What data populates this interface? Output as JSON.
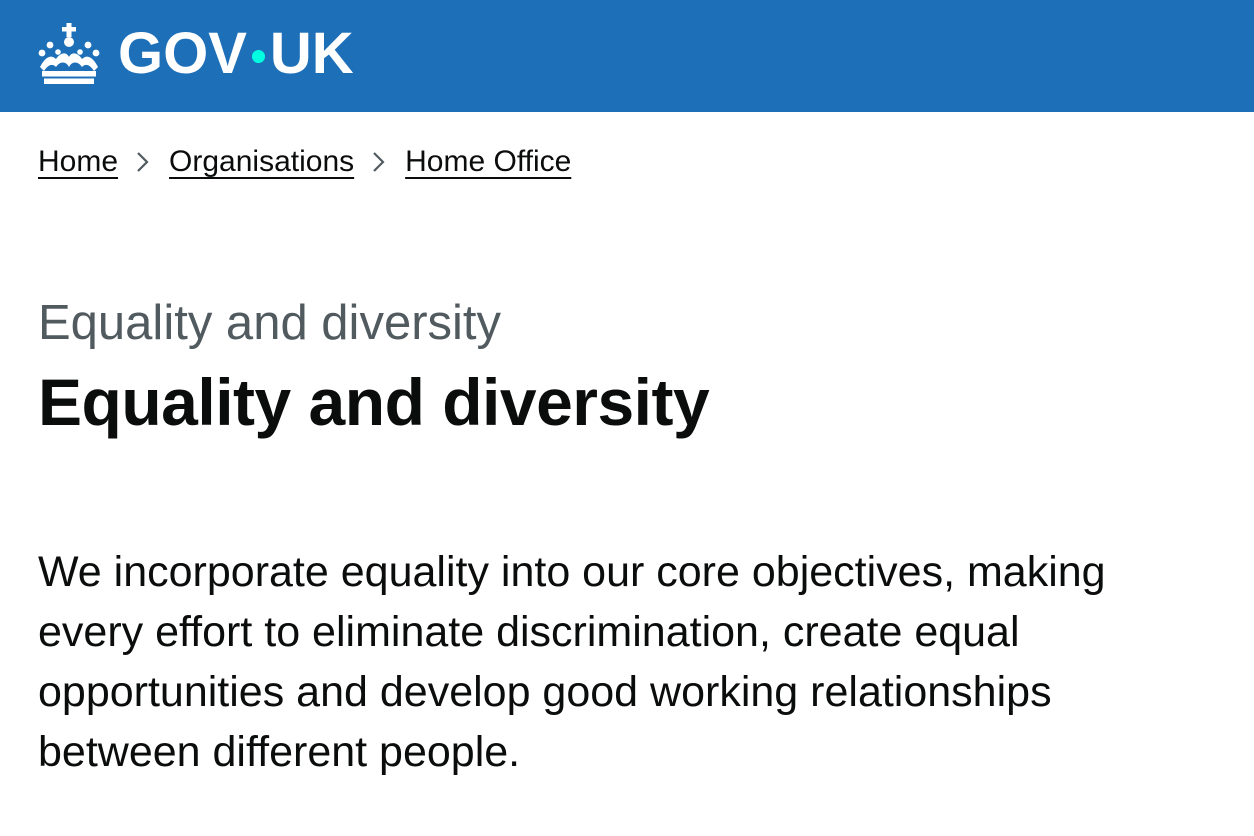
{
  "header": {
    "logo_text_left": "GOV",
    "logo_text_right": "UK",
    "logo_icon": "crown-icon",
    "brand_color": "#1d70b8",
    "dot_color": "#00ffe0"
  },
  "breadcrumbs": [
    {
      "label": "Home"
    },
    {
      "label": "Organisations"
    },
    {
      "label": "Home Office"
    }
  ],
  "breadcrumb_separator_icon": "chevron-right-icon",
  "page": {
    "caption": "Equality and diversity",
    "title": "Equality and diversity",
    "lead": "We incorporate equality into our core objectives, making every effort to eliminate discrimination, create equal opportunities and develop good working relationships between different people."
  }
}
